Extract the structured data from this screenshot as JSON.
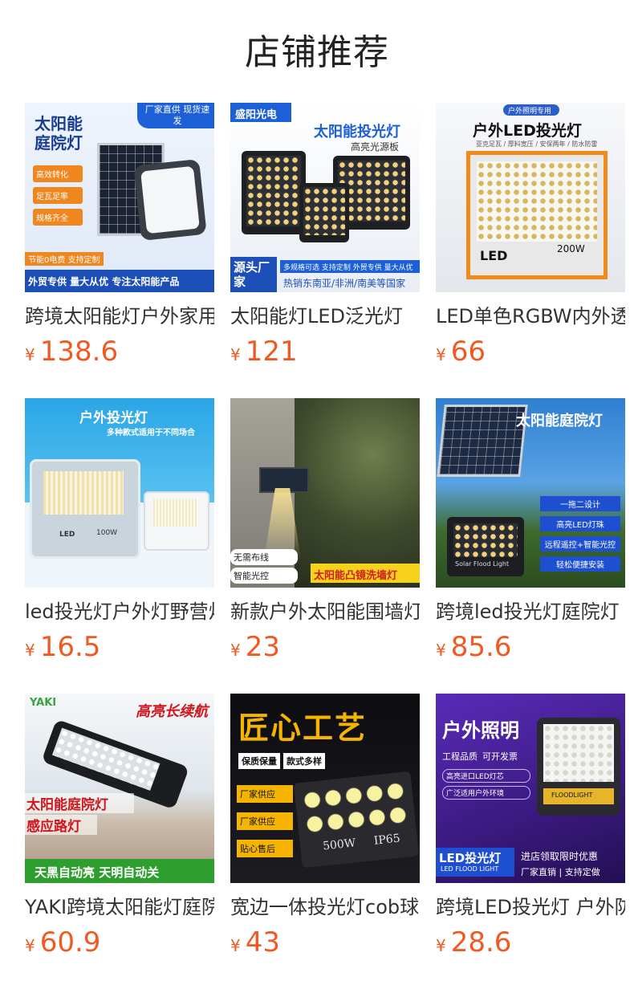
{
  "header": {
    "title": "店铺推荐"
  },
  "currency": "¥",
  "products": [
    {
      "name": "跨境太阳能灯户外家用庭院灯",
      "price": "138.6",
      "image": {
        "main": "太阳能庭院灯",
        "tag": "厂家直供 现货速发",
        "features": [
          "高效转化",
          "足瓦足率",
          "规格齐全"
        ],
        "note": "节能0电费 支持定制",
        "footer": "外贸专供  量大从优  专注太阳能产品"
      }
    },
    {
      "name": "太阳能灯LED泛光灯",
      "price": "121",
      "image": {
        "brand": "盛阳光电",
        "main": "太阳能投光灯",
        "sub": "高亮光源板",
        "badge": "源头厂家",
        "strip": "多规格可选 支持定制 外贸专供 量大从优",
        "regions": "热销东南亚/非洲/南美等国家"
      }
    },
    {
      "name": "LED单色RGBW内外透投光灯",
      "price": "66",
      "image": {
        "tag": "户外照明专用",
        "main": "户外LED投光灯",
        "sub": "亚克足瓦 / 厚料宽压 / 安保两年 / 防水防雷",
        "label": "LED",
        "watt": "200W"
      }
    },
    {
      "name": "led投光灯户外灯野营灯",
      "price": "16.5",
      "image": {
        "main": "户外投光灯",
        "sub": "多种款式适用于不同场合",
        "lamp": "LED",
        "watt": "100W"
      }
    },
    {
      "name": "新款户外太阳能围墙灯",
      "price": "23",
      "image": {
        "chips": [
          "无需布线",
          "智能光控"
        ],
        "banner": "太阳能凸镜洗墙灯"
      }
    },
    {
      "name": "跨境led投光灯庭院灯",
      "price": "85.6",
      "image": {
        "main": "太阳能庭院灯",
        "features": [
          "一拖二设计",
          "高亮LED灯珠",
          "远程遥控+智能光控",
          "轻松便捷安装"
        ],
        "lamp": "Solar Flood Light"
      }
    },
    {
      "name": "YAKI跨境太阳能灯庭院路灯",
      "price": "60.9",
      "image": {
        "logo": "YAKI",
        "main": "高亮长续航",
        "lines": [
          "太阳能庭院灯",
          "感应路灯"
        ],
        "footer": "天黑自动亮   天明自动关"
      }
    },
    {
      "name": "宽边一体投光灯cob球场灯",
      "price": "43",
      "image": {
        "main": "匠心工艺",
        "tags": [
          "保质保量",
          "款式多样"
        ],
        "features": [
          "厂家供应",
          "厂家供应",
          "贴心售后"
        ],
        "watt": "500W",
        "ip": "IP65"
      }
    },
    {
      "name": "跨境LED投光灯 户外防水",
      "price": "28.6",
      "image": {
        "main": "户外照明",
        "points": [
          "工程品质",
          "可开发票"
        ],
        "notes": [
          "高亮进口LED灯芯",
          "广泛适用户外环境"
        ],
        "badge_main": "LED投光灯",
        "badge_sub": "LED FLOOD LIGHT",
        "promo": "进店领取限时优惠",
        "promo_sub": "厂家直销 | 支持定做",
        "lamp": "FLOODLIGHT"
      }
    }
  ]
}
